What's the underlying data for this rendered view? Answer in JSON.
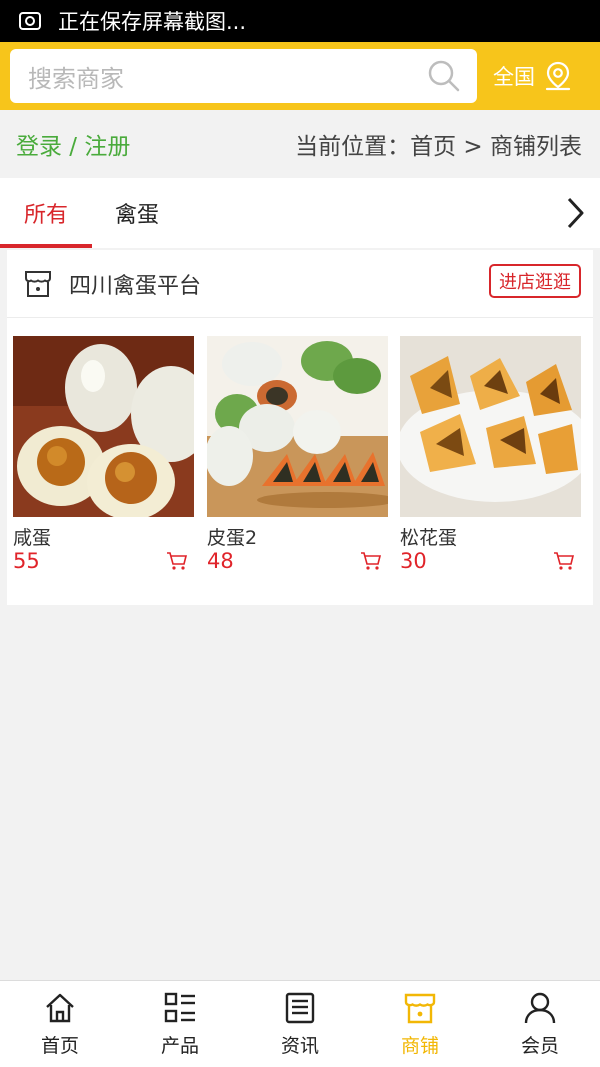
{
  "status_bar": {
    "text": "正在保存屏幕截图..."
  },
  "search": {
    "placeholder": "搜索商家",
    "region_label": "全国"
  },
  "location_bar": {
    "login_label": "登录 / 注册",
    "breadcrumb": "当前位置：首页 > 商铺列表"
  },
  "tabs": [
    {
      "label": "所有",
      "active": true
    },
    {
      "label": "禽蛋",
      "active": false
    }
  ],
  "shop": {
    "name": "四川禽蛋平台",
    "visit_label": "进店逛逛",
    "products": [
      {
        "name": "咸蛋",
        "price": "55"
      },
      {
        "name": "皮蛋2",
        "price": "48"
      },
      {
        "name": "松花蛋",
        "price": "30"
      }
    ]
  },
  "bottom_nav": [
    {
      "label": "首页",
      "icon": "home-icon"
    },
    {
      "label": "产品",
      "icon": "grid-list-icon"
    },
    {
      "label": "资讯",
      "icon": "news-icon"
    },
    {
      "label": "商铺",
      "icon": "shop-icon",
      "active": true
    },
    {
      "label": "会员",
      "icon": "user-icon"
    }
  ],
  "colors": {
    "brand_yellow": "#f7c51b",
    "accent_red": "#d8262b",
    "login_green": "#4aab3c",
    "nav_active": "#f2b705"
  }
}
